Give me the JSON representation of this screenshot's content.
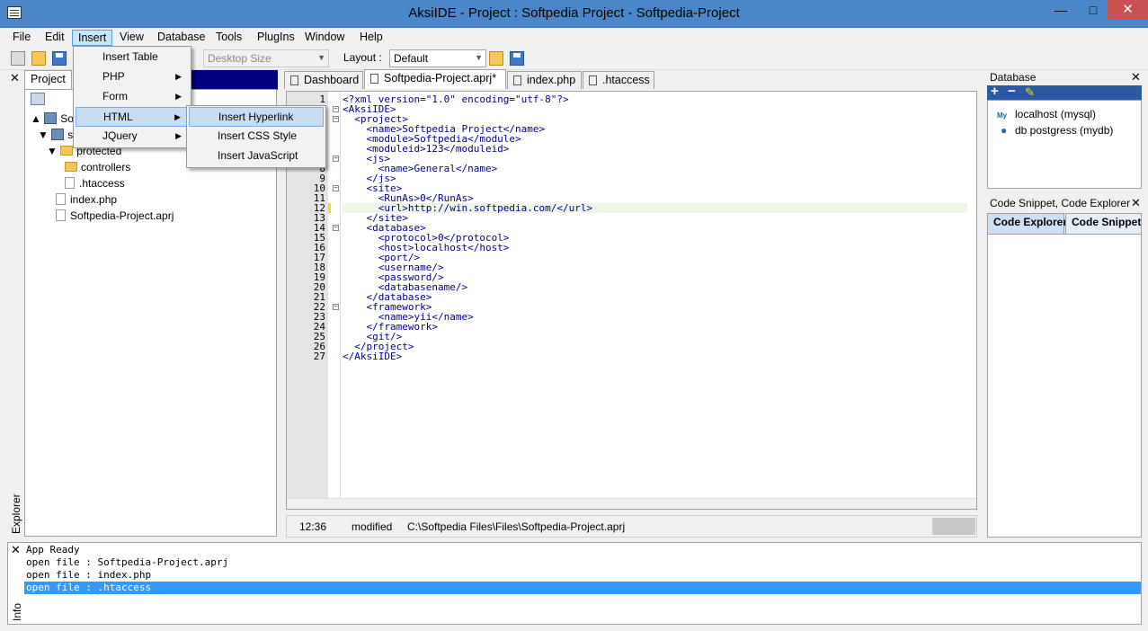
{
  "window": {
    "title": "AksiIDE - Project : Softpedia Project - Softpedia-Project",
    "minimize": "—",
    "maximize": "□",
    "close": "✕"
  },
  "menubar": [
    "File",
    "Edit",
    "Insert",
    "View",
    "Database",
    "Tools",
    "PlugIns",
    "Window",
    "Help"
  ],
  "toolbar": {
    "desktop_size": "Desktop Size",
    "layout_label": "Layout :",
    "layout_value": "Default"
  },
  "insert_menu": {
    "items": [
      "Insert Table",
      "PHP",
      "Form",
      "HTML",
      "JQuery"
    ],
    "html_submenu": [
      "Insert Hyperlink",
      "Insert CSS Style",
      "Insert JavaScript"
    ]
  },
  "explorer": {
    "tab": "Project",
    "side_label": "Explorer",
    "tree": [
      "Soft",
      "sr",
      "protected",
      "controllers",
      ".htaccess",
      "index.php",
      "Softpedia-Project.aprj"
    ]
  },
  "editor": {
    "tabs": [
      "Dashboard",
      "Softpedia-Project.aprj*",
      "index.php",
      ".htaccess"
    ],
    "lines": [
      "<?xml version=\"1.0\" encoding=\"utf-8\"?>",
      "<AksiIDE>",
      "  <project>",
      "    <name>Softpedia Project</name>",
      "    <module>Softpedia</module>",
      "    <moduleid>123</moduleid>",
      "    <js>",
      "      <name>General</name>",
      "    </js>",
      "    <site>",
      "      <RunAs>0</RunAs>",
      "      <url>http://win.softpedia.com/</url>",
      "    </site>",
      "    <database>",
      "      <protocol>0</protocol>",
      "      <host>localhost</host>",
      "      <port/>",
      "      <username/>",
      "      <password/>",
      "      <databasename/>",
      "    </database>",
      "    <framework>",
      "      <name>yii</name>",
      "    </framework>",
      "    <git/>",
      "  </project>",
      "</AksiIDE>"
    ],
    "status": {
      "position": "12:36",
      "state": "modified",
      "path": "C:\\Softpedia Files\\Files\\Softpedia-Project.aprj"
    }
  },
  "database_panel": {
    "title": "Database",
    "items": [
      "localhost (mysql)",
      "db postgress (mydb)"
    ]
  },
  "snippet_panel": {
    "title": "Code Snippet, Code Explorer",
    "tabs": [
      "Code Explorer",
      "Code Snippet"
    ]
  },
  "info_panel": {
    "side_label": "Info",
    "logs": [
      "App Ready",
      "open file : Softpedia-Project.aprj",
      "open file : index.php",
      "open file : .htaccess"
    ]
  },
  "colors": {
    "titlebar": "#4a86c8",
    "selection": "#3399ff",
    "tag": "#00008b"
  }
}
